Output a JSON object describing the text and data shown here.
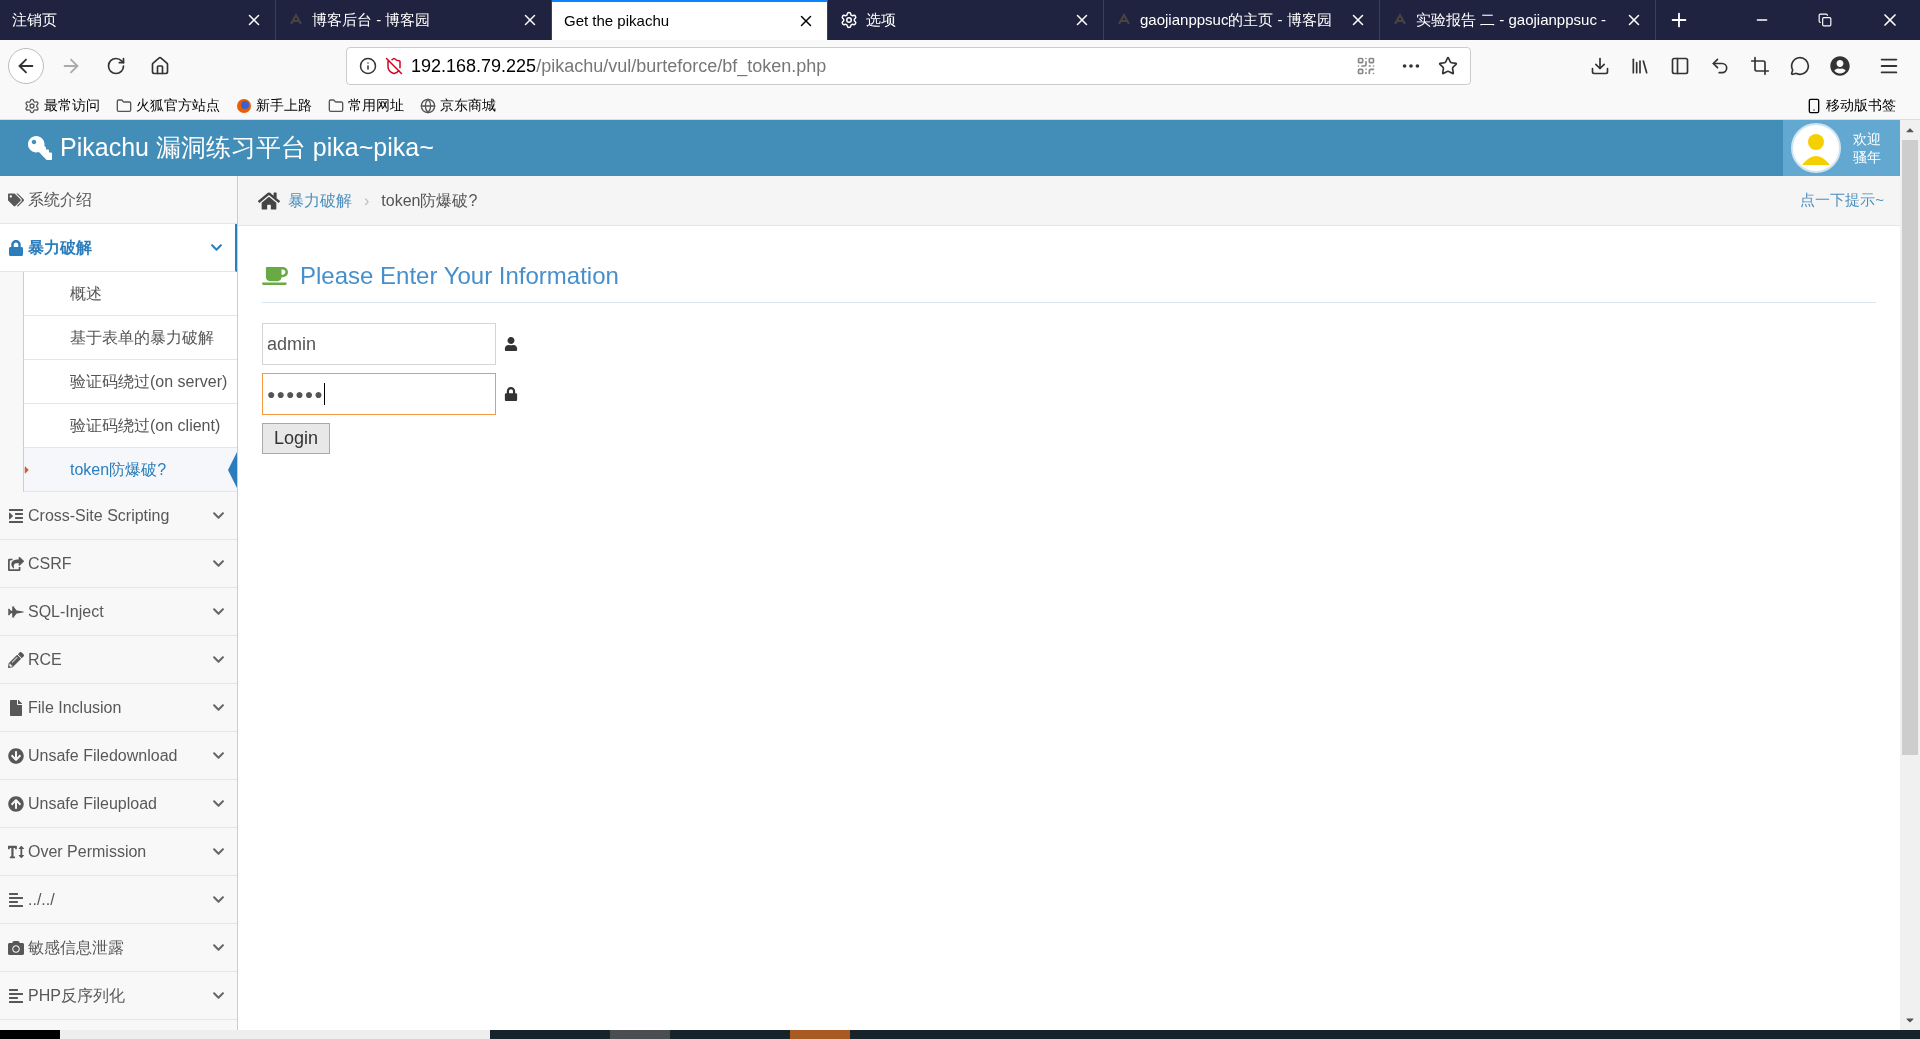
{
  "browser": {
    "tabs": [
      {
        "title": "注销页",
        "selected": false
      },
      {
        "title": "博客后台 - 博客园",
        "selected": false
      },
      {
        "title": "Get the pikachu",
        "selected": true
      },
      {
        "title": "选项",
        "selected": false
      },
      {
        "title": "gaojianppsuc的主页 - 博客园",
        "selected": false
      },
      {
        "title": "实验报告 二 - gaojianppsuc -",
        "selected": false
      }
    ],
    "url": {
      "host": "192.168.79.225",
      "path": "/pikachu/vul/burteforce/bf_token.php"
    },
    "bookmarks": [
      "最常访问",
      "火狐官方站点",
      "新手上路",
      "常用网址",
      "京东商城"
    ],
    "mobile_bookmarks": "移动版书签"
  },
  "header": {
    "title": "Pikachu 漏洞练习平台 pika~pika~",
    "greeting": [
      "欢迎",
      "骚年"
    ]
  },
  "sidebar": [
    {
      "label": "系统介绍",
      "expanded": false
    },
    {
      "label": "暴力破解",
      "expanded": true,
      "children": [
        {
          "label": "概述",
          "selected": false
        },
        {
          "label": "基于表单的暴力破解",
          "selected": false
        },
        {
          "label": "验证码绕过(on server)",
          "selected": false
        },
        {
          "label": "验证码绕过(on client)",
          "selected": false
        },
        {
          "label": "token防爆破?",
          "selected": true
        }
      ]
    },
    {
      "label": "Cross-Site Scripting",
      "expanded": false
    },
    {
      "label": "CSRF",
      "expanded": false
    },
    {
      "label": "SQL-Inject",
      "expanded": false
    },
    {
      "label": "RCE",
      "expanded": false
    },
    {
      "label": "File Inclusion",
      "expanded": false
    },
    {
      "label": "Unsafe Filedownload",
      "expanded": false
    },
    {
      "label": "Unsafe Fileupload",
      "expanded": false
    },
    {
      "label": "Over Permission",
      "expanded": false
    },
    {
      "label": "../../",
      "expanded": false
    },
    {
      "label": "敏感信息泄露",
      "expanded": false
    },
    {
      "label": "PHP反序列化",
      "expanded": false
    }
  ],
  "breadcrumb": {
    "parent": "暴力破解",
    "separator": "›",
    "current": "token防爆破?",
    "hint": "点一下提示~"
  },
  "form": {
    "heading": "Please Enter Your Information",
    "username": "admin",
    "password_mask": "●●●●●●",
    "password_focused": true,
    "button": "Login"
  }
}
